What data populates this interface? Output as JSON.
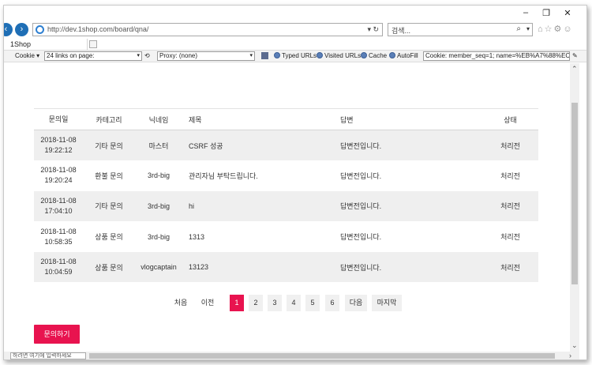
{
  "window": {
    "minimize": "–",
    "maximize": "❐",
    "close": "✕"
  },
  "address_bar": {
    "url": "http://dev.1shop.com/board/qna/",
    "tools": "▾ ↻"
  },
  "search": {
    "placeholder": "검색...",
    "icon": "⌕",
    "dropdown": "▾"
  },
  "ie_icons": "⌂☆⚙☺",
  "tab": {
    "label": "1Shop"
  },
  "toolbar": {
    "cookie_label": "Cookie",
    "links_select": "24 links on page:",
    "proxy_select": "Proxy: (none)",
    "typed_urls": "Typed URLs",
    "visited_urls": "Visited URLs",
    "cache": "Cache",
    "autofill": "AutoFill",
    "cookie_value": "Cookie: member_seq=1; name=%EB%A7%88%EC%8A%A4"
  },
  "table": {
    "headers": {
      "date": "문의일",
      "category": "카테고리",
      "nickname": "닉네임",
      "title": "제목",
      "answer": "답변",
      "state": "상태"
    },
    "rows": [
      {
        "date": "2018-11-08",
        "time": "19:22:12",
        "category": "기타 문의",
        "nickname": "마스터",
        "title": "CSRF 성공",
        "answer": "답변전입니다.",
        "state": "처리전"
      },
      {
        "date": "2018-11-08",
        "time": "19:20:24",
        "category": "환불 문의",
        "nickname": "3rd-big",
        "title": "관리자님 부탁드립니다.",
        "answer": "답변전입니다.",
        "state": "처리전"
      },
      {
        "date": "2018-11-08",
        "time": "17:04:10",
        "category": "기타 문의",
        "nickname": "3rd-big",
        "title": "hi",
        "answer": "답변전입니다.",
        "state": "처리전"
      },
      {
        "date": "2018-11-08",
        "time": "10:58:35",
        "category": "상품 문의",
        "nickname": "3rd-big",
        "title": "1313",
        "answer": "답변전입니다.",
        "state": "처리전"
      },
      {
        "date": "2018-11-08",
        "time": "10:04:59",
        "category": "상품 문의",
        "nickname": "vlogcaptain",
        "title": "13123",
        "answer": "답변전입니다.",
        "state": "처리전"
      }
    ]
  },
  "pagination": {
    "first": "처음",
    "prev": "이전",
    "pages": [
      "1",
      "2",
      "3",
      "4",
      "5",
      "6"
    ],
    "next": "다음",
    "last": "마지막",
    "current": "1"
  },
  "ask_button": "문의하기",
  "statusbar": {
    "input_placeholder": "하려면 여기에 입력하세요"
  },
  "colors": {
    "accent": "#e8134f",
    "row_shade": "#efefef"
  }
}
